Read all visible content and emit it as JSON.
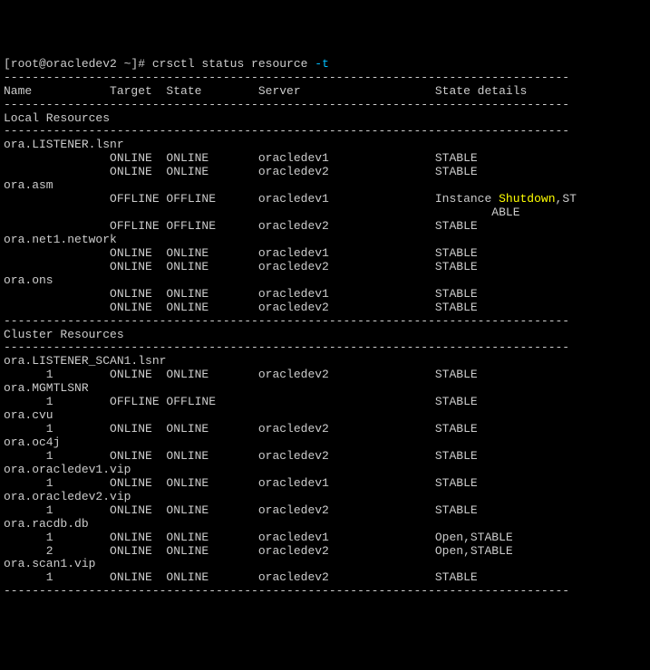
{
  "prompt": "[root@oracledev2 ~]# crsctl status resource ",
  "flag": "-t",
  "sep": "--------------------------------------------------------------------------------",
  "header": "Name           Target  State        Server                   State details",
  "sections": [
    {
      "title": "Local Resources",
      "resources": [
        {
          "name": "ora.LISTENER.lsnr",
          "rows": [
            {
              "inst": "               ",
              "target": "ONLINE ",
              "state": "ONLINE ",
              "server": "oracledev1              ",
              "details": "STABLE"
            },
            {
              "inst": "               ",
              "target": "ONLINE ",
              "state": "ONLINE ",
              "server": "oracledev2              ",
              "details": "STABLE"
            }
          ]
        },
        {
          "name": "ora.asm",
          "rows": [
            {
              "inst": "               ",
              "target": "OFFLINE",
              "state": "OFFLINE",
              "server": "oracledev1              ",
              "details": "Instance ",
              "highlight": "Shutdown",
              "details2": ",ST"
            },
            {
              "inst": "                                                                     ",
              "target": "",
              "state": "",
              "server": "",
              "details": "ABLE"
            },
            {
              "inst": "               ",
              "target": "OFFLINE",
              "state": "OFFLINE",
              "server": "oracledev2              ",
              "details": "STABLE"
            }
          ]
        },
        {
          "name": "ora.net1.network",
          "rows": [
            {
              "inst": "               ",
              "target": "ONLINE ",
              "state": "ONLINE ",
              "server": "oracledev1              ",
              "details": "STABLE"
            },
            {
              "inst": "               ",
              "target": "ONLINE ",
              "state": "ONLINE ",
              "server": "oracledev2              ",
              "details": "STABLE"
            }
          ]
        },
        {
          "name": "ora.ons",
          "rows": [
            {
              "inst": "               ",
              "target": "ONLINE ",
              "state": "ONLINE ",
              "server": "oracledev1              ",
              "details": "STABLE"
            },
            {
              "inst": "               ",
              "target": "ONLINE ",
              "state": "ONLINE ",
              "server": "oracledev2              ",
              "details": "STABLE"
            }
          ]
        }
      ]
    },
    {
      "title": "Cluster Resources",
      "resources": [
        {
          "name": "ora.LISTENER_SCAN1.lsnr",
          "rows": [
            {
              "inst": "      1        ",
              "target": "ONLINE ",
              "state": "ONLINE ",
              "server": "oracledev2              ",
              "details": "STABLE"
            }
          ]
        },
        {
          "name": "ora.MGMTLSNR",
          "rows": [
            {
              "inst": "      1        ",
              "target": "OFFLINE",
              "state": "OFFLINE",
              "server": "                        ",
              "details": "STABLE"
            }
          ]
        },
        {
          "name": "ora.cvu",
          "rows": [
            {
              "inst": "      1        ",
              "target": "ONLINE ",
              "state": "ONLINE ",
              "server": "oracledev2              ",
              "details": "STABLE"
            }
          ]
        },
        {
          "name": "ora.oc4j",
          "rows": [
            {
              "inst": "      1        ",
              "target": "ONLINE ",
              "state": "ONLINE ",
              "server": "oracledev2              ",
              "details": "STABLE"
            }
          ]
        },
        {
          "name": "ora.oracledev1.vip",
          "rows": [
            {
              "inst": "      1        ",
              "target": "ONLINE ",
              "state": "ONLINE ",
              "server": "oracledev1              ",
              "details": "STABLE"
            }
          ]
        },
        {
          "name": "ora.oracledev2.vip",
          "rows": [
            {
              "inst": "      1        ",
              "target": "ONLINE ",
              "state": "ONLINE ",
              "server": "oracledev2              ",
              "details": "STABLE"
            }
          ]
        },
        {
          "name": "ora.racdb.db",
          "rows": [
            {
              "inst": "      1        ",
              "target": "ONLINE ",
              "state": "ONLINE ",
              "server": "oracledev1              ",
              "details": "Open,STABLE"
            },
            {
              "inst": "      2        ",
              "target": "ONLINE ",
              "state": "ONLINE ",
              "server": "oracledev2              ",
              "details": "Open,STABLE"
            }
          ]
        },
        {
          "name": "ora.scan1.vip",
          "rows": [
            {
              "inst": "      1        ",
              "target": "ONLINE ",
              "state": "ONLINE ",
              "server": "oracledev2              ",
              "details": "STABLE"
            }
          ]
        }
      ]
    }
  ]
}
